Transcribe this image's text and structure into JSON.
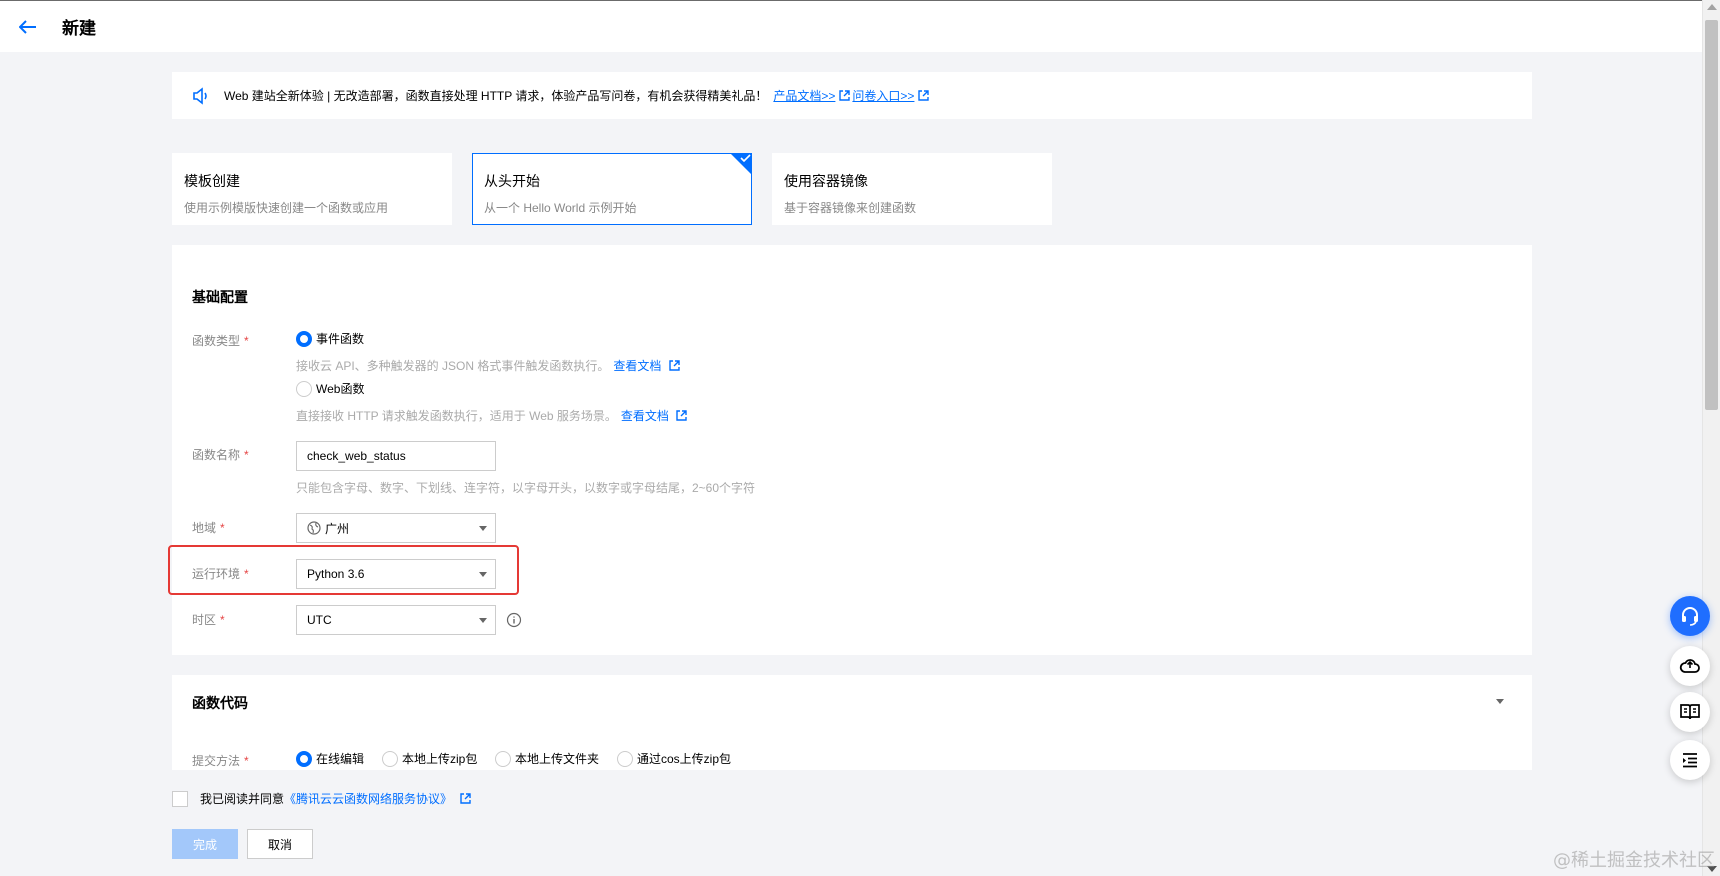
{
  "header": {
    "title": "新建"
  },
  "notice": {
    "text": "Web 建站全新体验 | 无改造部署，函数直接处理 HTTP 请求，体验产品写问卷，有机会获得精美礼品！",
    "link1": "产品文档>>",
    "link2": "问卷入口>>"
  },
  "create_methods": [
    {
      "title": "模板创建",
      "desc": "使用示例模版快速创建一个函数或应用"
    },
    {
      "title": "从头开始",
      "desc": "从一个 Hello World 示例开始"
    },
    {
      "title": "使用容器镜像",
      "desc": "基于容器镜像来创建函数"
    }
  ],
  "basic": {
    "section_title": "基础配置",
    "function_type": {
      "label": "函数类型",
      "options": [
        {
          "label": "事件函数",
          "help": "接收云 API、多种触发器的 JSON 格式事件触发函数执行。",
          "link": "查看文档"
        },
        {
          "label": "Web函数",
          "help": "直接接收 HTTP 请求触发函数执行，适用于 Web 服务场景。",
          "link": "查看文档"
        }
      ]
    },
    "function_name": {
      "label": "函数名称",
      "value": "check_web_status",
      "help": "只能包含字母、数字、下划线、连字符，以字母开头，以数字或字母结尾，2~60个字符"
    },
    "region": {
      "label": "地域",
      "value": "广州"
    },
    "runtime": {
      "label": "运行环境",
      "value": "Python 3.6"
    },
    "timezone": {
      "label": "时区",
      "value": "UTC"
    },
    "required_mark": "*"
  },
  "code": {
    "section_title": "函数代码",
    "submit_method": {
      "label": "提交方法",
      "options": [
        "在线编辑",
        "本地上传zip包",
        "本地上传文件夹",
        "通过cos上传zip包"
      ]
    }
  },
  "agreement": {
    "text": "我已阅读并同意",
    "link": "《腾讯云云函数网络服务协议》"
  },
  "buttons": {
    "finish": "完成",
    "cancel": "取消"
  },
  "watermark": "@稀土掘金技术社区",
  "colors": {
    "primary": "#006eff",
    "highlight": "#e53935",
    "float_blue": "#1f6eff"
  }
}
